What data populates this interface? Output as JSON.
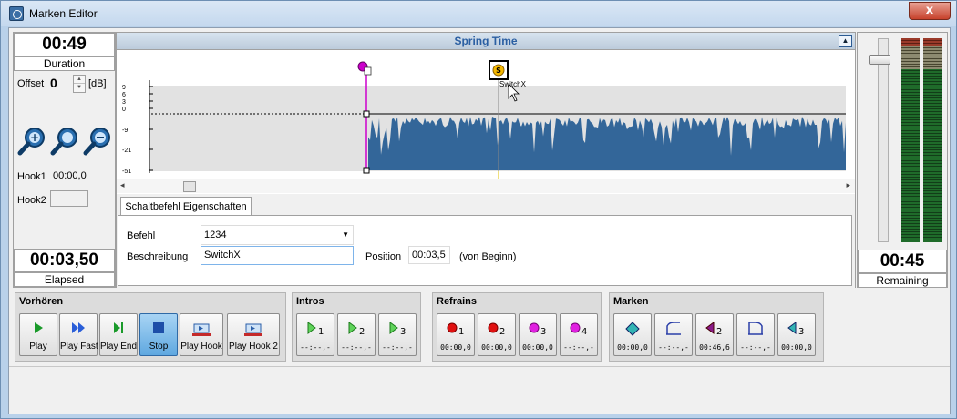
{
  "window": {
    "title": "Marken Editor",
    "close": "x"
  },
  "left": {
    "duration": "00:49",
    "duration_label": "Duration",
    "offset_label": "Offset",
    "offset_value": "0",
    "offset_unit": "[dB]",
    "hook1_label": "Hook1",
    "hook1_value": "00:00,0",
    "hook2_label": "Hook2",
    "hook2_value": "",
    "elapsed": "00:03,50",
    "elapsed_label": "Elapsed"
  },
  "wave": {
    "title": "Spring Time",
    "db_ticks": [
      "9",
      "6",
      "3",
      "0",
      "-9",
      "-21",
      "-51"
    ],
    "marker_label": "SwitchX",
    "marker_symbol": "S",
    "wave_color": "#336699",
    "hook_color": "#cc00cc"
  },
  "props": {
    "tab": "Schaltbefehl Eigenschaften",
    "befehl_label": "Befehl",
    "befehl_value": "1234",
    "beschreibung_label": "Beschreibung",
    "beschreibung_value": "SwitchX",
    "position_label": "Position",
    "position_value": "00:03,5",
    "position_suffix": "(von Beginn)"
  },
  "right": {
    "remaining": "00:45",
    "remaining_label": "Remaining"
  },
  "vorhoeren": {
    "title": "Vorhören",
    "buttons": [
      "Play",
      "Play Fast",
      "Play End",
      "Stop",
      "Play Hook",
      "Play Hook 2"
    ]
  },
  "intros": {
    "title": "Intros",
    "buttons": [
      {
        "sub": "1",
        "time": "--:--,-"
      },
      {
        "sub": "2",
        "time": "--:--,-"
      },
      {
        "sub": "3",
        "time": "--:--,-"
      }
    ]
  },
  "refrains": {
    "title": "Refrains",
    "buttons": [
      {
        "sub": "1",
        "time": "00:00,0",
        "color": "#e01010"
      },
      {
        "sub": "2",
        "time": "00:00,0",
        "color": "#e01010"
      },
      {
        "sub": "3",
        "time": "00:00,0",
        "color": "#e020e0"
      },
      {
        "sub": "4",
        "time": "--:--,-",
        "color": "#e020e0"
      }
    ]
  },
  "marken": {
    "title": "Marken",
    "buttons": [
      {
        "sub": "",
        "time": "00:00,0"
      },
      {
        "sub": "",
        "time": "--:--,-"
      },
      {
        "sub": "2",
        "time": "00:46,6"
      },
      {
        "sub": "",
        "time": "--:--,-"
      },
      {
        "sub": "3",
        "time": "00:00,0"
      }
    ]
  }
}
